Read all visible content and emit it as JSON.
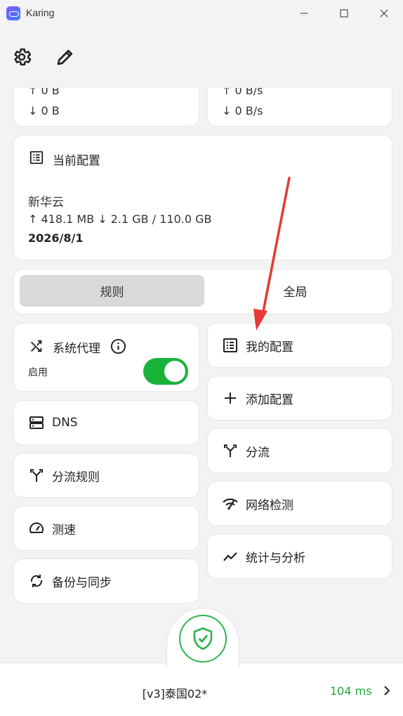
{
  "window": {
    "title": "Karing"
  },
  "traffic": {
    "left_down": "↓ 0 B",
    "right_down": "↓ 0 B/s",
    "left_up": "↑ 0 B",
    "right_up": "↑ 0 B/s"
  },
  "current_profile": {
    "heading": "当前配置",
    "name": "新华云",
    "usage": "↑ 418.1 MB ↓ 2.1 GB / 110.0 GB",
    "expiry": "2026/8/1"
  },
  "mode": {
    "options": [
      "规则",
      "全局"
    ],
    "selected": "规则"
  },
  "system_proxy": {
    "label": "系统代理",
    "status": "启用",
    "enabled": true
  },
  "tiles_left": [
    "DNS",
    "分流规则",
    "测速",
    "备份与同步"
  ],
  "tiles_right": [
    "我的配置",
    "添加配置",
    "分流",
    "网络检测",
    "统计与分析"
  ],
  "bottom": {
    "node": "[v3]泰国02*",
    "latency": "104 ms"
  },
  "colors": {
    "accent_green": "#19b23b",
    "latency_green": "#1fa83a",
    "annotation_arrow": "#e53935"
  }
}
